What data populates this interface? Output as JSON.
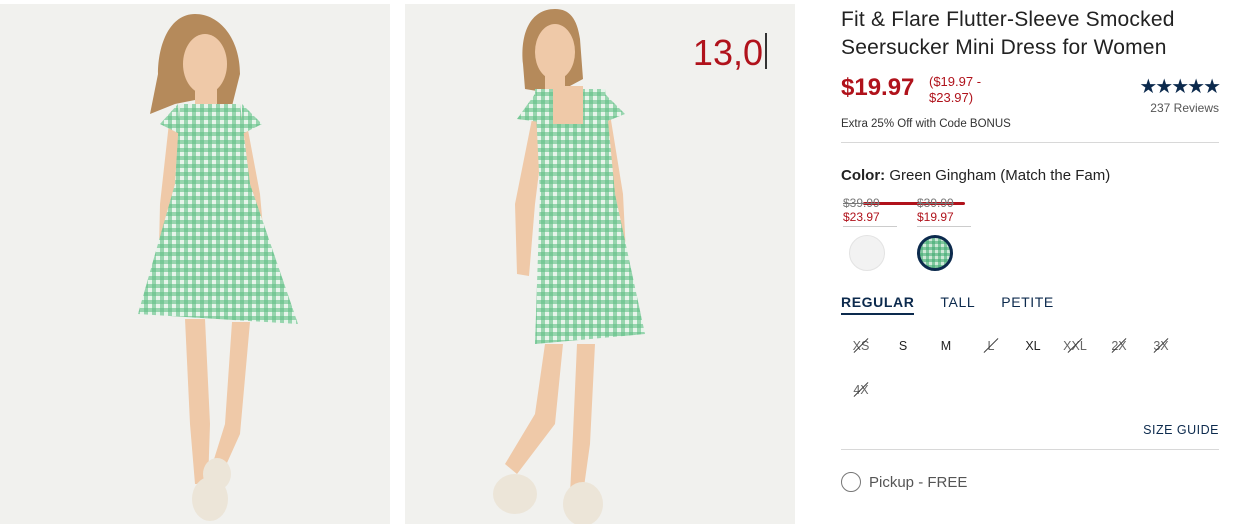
{
  "product": {
    "title": "Fit & Flare Flutter-Sleeve Smocked Seersucker Mini Dress for Women",
    "sale_price": "$19.97",
    "price_range": "($19.97 - $23.97)",
    "promo": "Extra 25% Off with Code BONUS",
    "rating_stars": "★★★★★",
    "rating": 4.5,
    "reviews": "237 Reviews"
  },
  "annotation": {
    "text": "13,0"
  },
  "color": {
    "label": "Color:",
    "value": "Green Gingham (Match the Fam)",
    "swatches": [
      {
        "was": "$39.99",
        "now": "$23.97",
        "name": "white-swatch"
      },
      {
        "was": "$39.99",
        "now": "$19.97",
        "name": "green-gingham-swatch"
      }
    ]
  },
  "fits": [
    "REGULAR",
    "TALL",
    "PETITE"
  ],
  "sizes": [
    "XS",
    "S",
    "M",
    "L",
    "XL",
    "XXL",
    "2X",
    "3X",
    "4X"
  ],
  "size_guide": "SIZE GUIDE",
  "pickup": "Pickup - FREE",
  "colors": {
    "accent": "#b0121b",
    "navy": "#0c2a4d"
  }
}
